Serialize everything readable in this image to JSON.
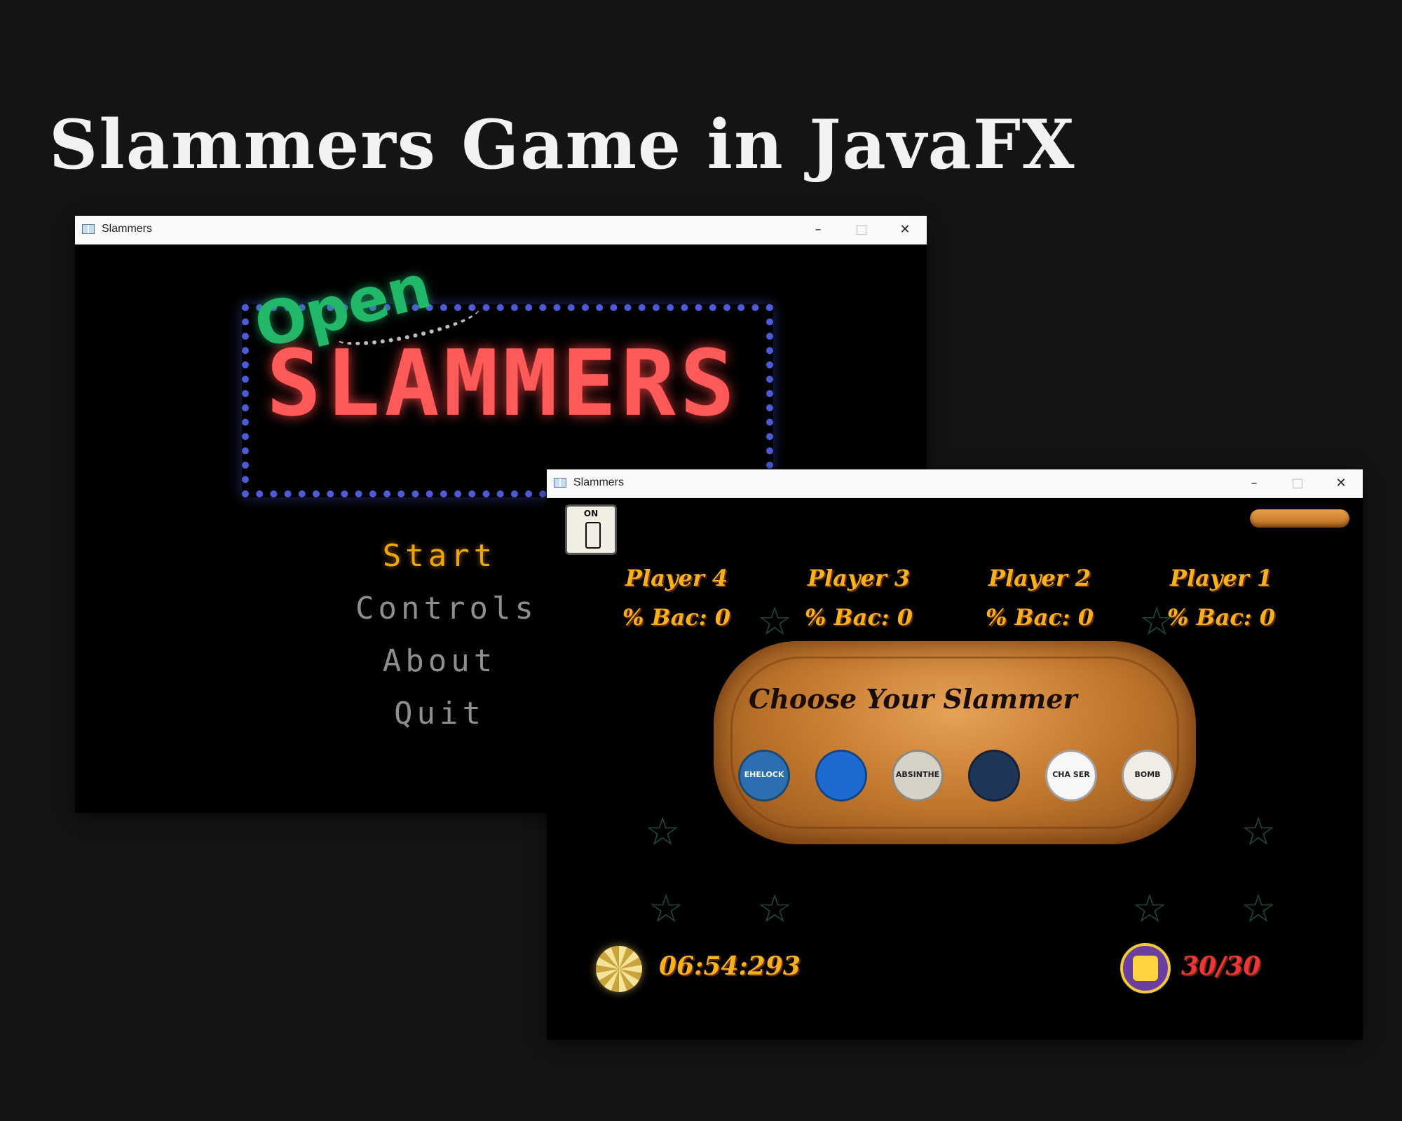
{
  "page": {
    "title": "Slammers Game in JavaFX"
  },
  "menu_window": {
    "title": "Slammers",
    "sign": {
      "open": "Open",
      "main": "SLAMMERS"
    },
    "menu_items": [
      "Start",
      "Controls",
      "About",
      "Quit"
    ],
    "window_controls": {
      "minimize": "–",
      "maximize": "□",
      "close": "✕"
    }
  },
  "game_window": {
    "title": "Slammers",
    "power_switch": "ON",
    "players": [
      {
        "name": "Player 4",
        "bac": "% Bac: 0"
      },
      {
        "name": "Player 3",
        "bac": "% Bac: 0"
      },
      {
        "name": "Player 2",
        "bac": "% Bac: 0"
      },
      {
        "name": "Player 1",
        "bac": "% Bac: 0"
      }
    ],
    "tray_heading": "Choose Your Slammer",
    "slammers": [
      {
        "label": "EHELOCK",
        "color": "#2b6fb0"
      },
      {
        "label": "",
        "color": "#1d6bd0"
      },
      {
        "label": "ABSINTHE",
        "color": "#d7d2c8"
      },
      {
        "label": "",
        "color": "#1f3558"
      },
      {
        "label": "CHA SER",
        "color": "#f7f7f7"
      },
      {
        "label": "BOMB",
        "color": "#f2ece6"
      }
    ],
    "timer": "06:54:293",
    "count": "30/30",
    "window_controls": {
      "minimize": "–",
      "maximize": "□",
      "close": "✕"
    }
  }
}
